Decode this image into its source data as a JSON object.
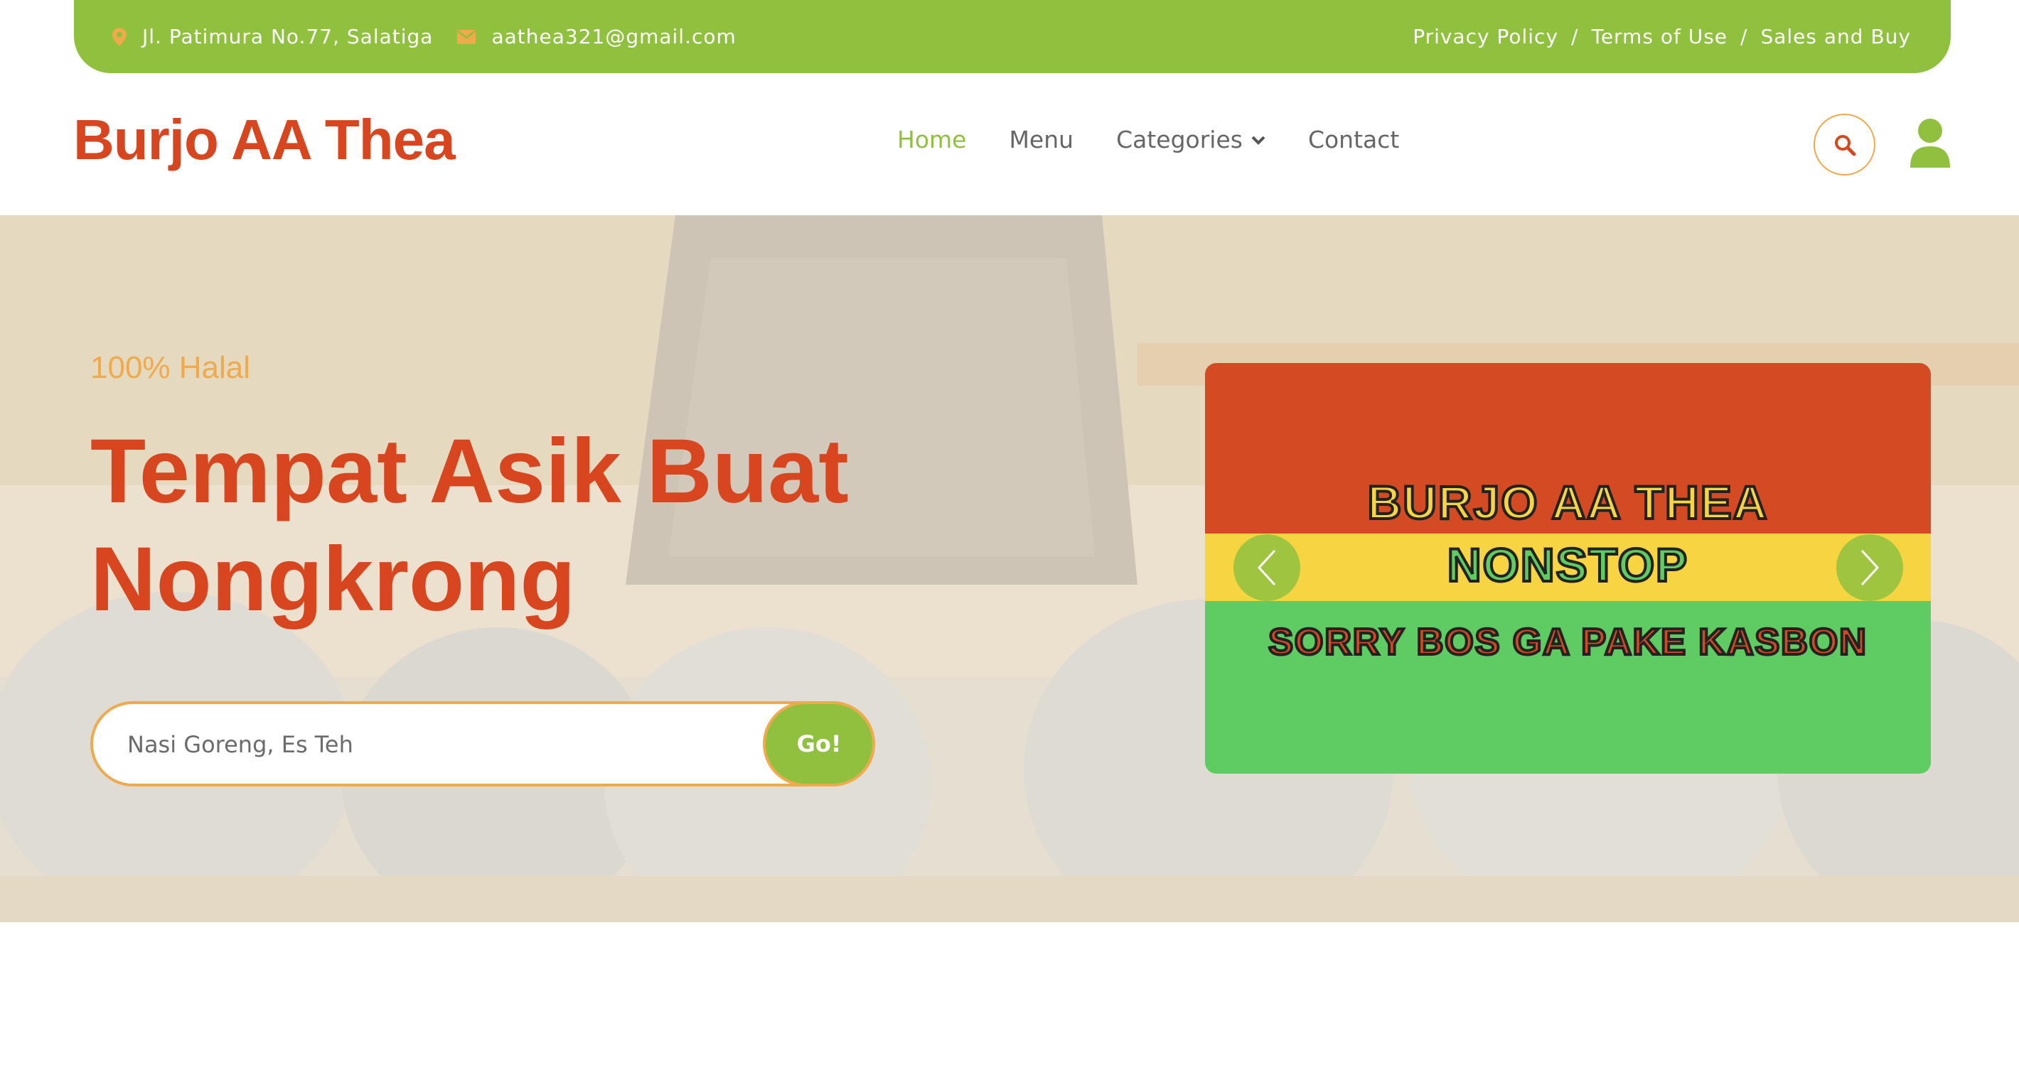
{
  "topbar": {
    "address": "Jl. Patimura No.77, Salatiga",
    "email": "aathea321@gmail.com",
    "links": [
      "Privacy Policy",
      "Terms of Use",
      "Sales and Buy"
    ],
    "separator": "/",
    "bg_color": "#8fc13e",
    "icon_color": "#f0a94b"
  },
  "header": {
    "logo": "Burjo AA Thea",
    "nav": {
      "home": "Home",
      "menu": "Menu",
      "categories": "Categories",
      "contact": "Contact"
    },
    "active_color": "#8fc13e",
    "brand_color": "#d7461f"
  },
  "hero": {
    "tagline": "100% Halal",
    "headline": "Tempat Asik Buat Nongkrong",
    "search": {
      "placeholder": "Nasi Goreng, Es Teh",
      "button": "Go!"
    },
    "carousel": {
      "line1": "BURJO AA THEA",
      "line2": "NONSTOP",
      "line3": "SORRY BOS GA PAKE KASBON"
    }
  }
}
